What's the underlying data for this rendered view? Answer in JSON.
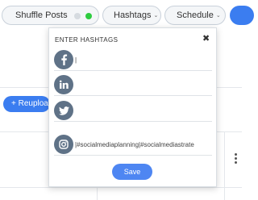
{
  "toolbar": {
    "shuffle_label": "Shuffle Posts",
    "hashtags_label": "Hashtags",
    "schedule_label": "Schedule",
    "dropdown_glyph": "⌄"
  },
  "background": {
    "reupload_label": "+ Reupload"
  },
  "modal": {
    "title": "ENTER HASHTAGS",
    "close_glyph": "✖",
    "rows": [
      {
        "network": "facebook",
        "icon": "facebook-icon",
        "value": "|"
      },
      {
        "network": "linkedin",
        "icon": "linkedin-icon",
        "value": ""
      },
      {
        "network": "twitter",
        "icon": "twitter-icon",
        "value": ""
      },
      {
        "network": "instagram",
        "icon": "instagram-icon",
        "value": "|#socialmediaplanning|#socialmediastrate"
      }
    ],
    "save_label": "Save"
  },
  "colors": {
    "accent_blue": "#3b7df0",
    "save_blue": "#4e86f2",
    "social_icon_bg": "#5f7287",
    "toggle_on": "#2ecc40",
    "toggle_off": "#d6dbe0"
  }
}
